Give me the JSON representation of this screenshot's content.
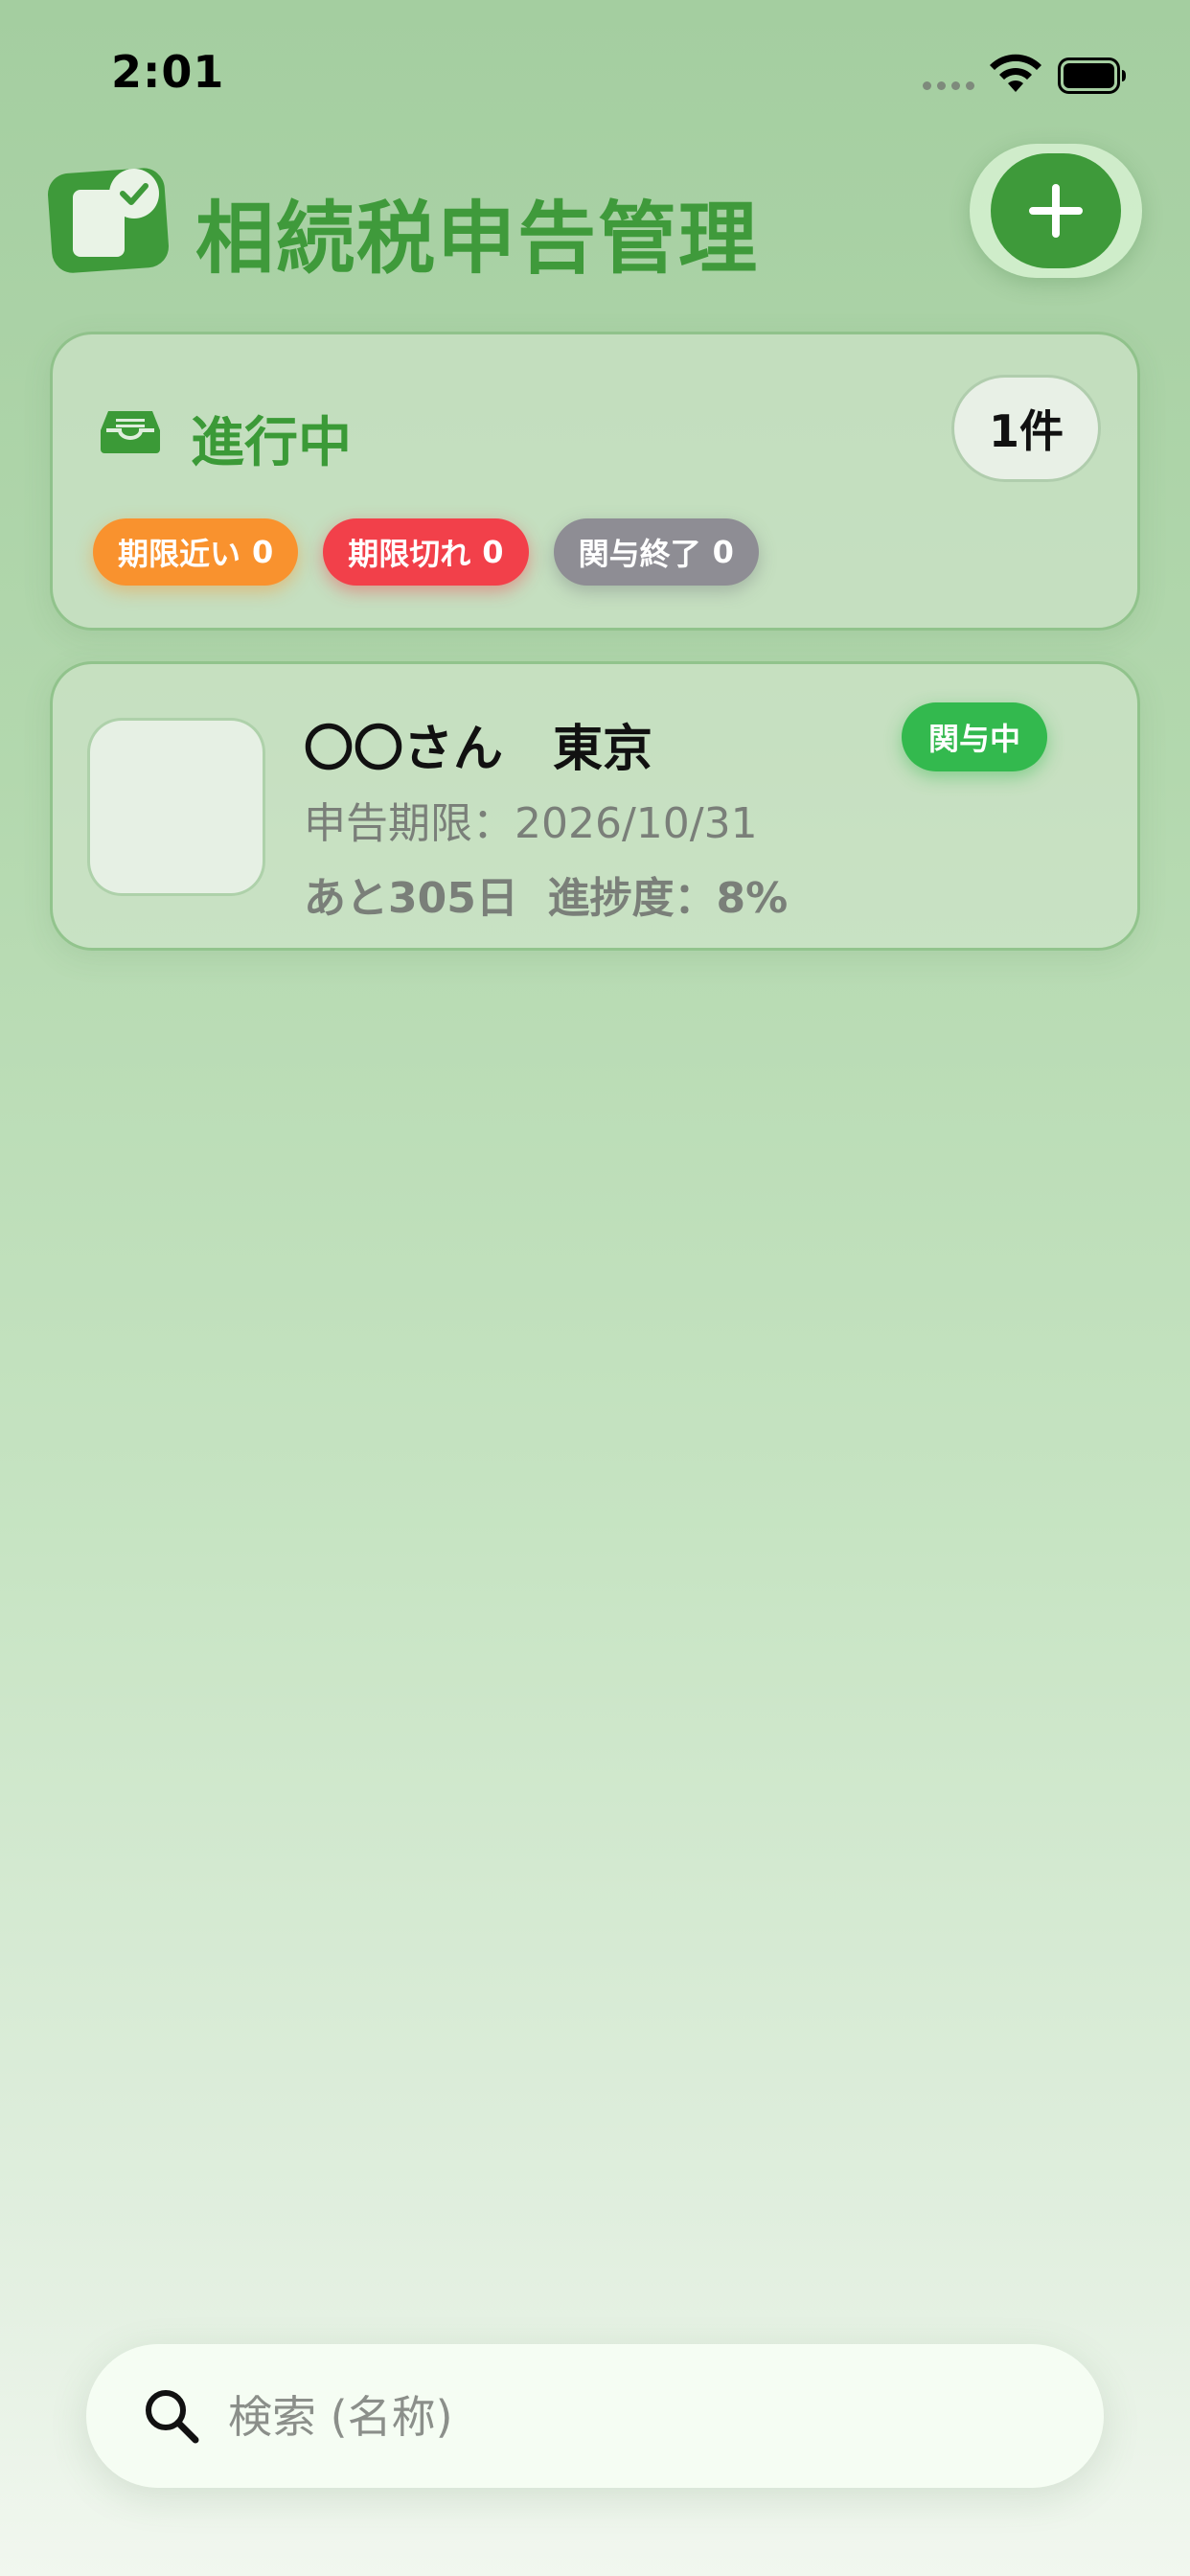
{
  "status_bar": {
    "time": "2:01",
    "icons": [
      "cellular-signal-icon",
      "wifi-icon",
      "battery-icon"
    ]
  },
  "header": {
    "title": "相続税申告管理",
    "app_icon": "document-check-icon",
    "add_button_icon": "plus-icon"
  },
  "progress_card": {
    "icon": "inbox-tray-icon",
    "title": "進行中",
    "count": "1件",
    "badges": [
      {
        "label": "期限近い",
        "count": "0",
        "color": "#f9922e"
      },
      {
        "label": "期限切れ",
        "count": "0",
        "color": "#f2404a"
      },
      {
        "label": "関与終了",
        "count": "0",
        "color": "#8e8d94"
      }
    ]
  },
  "clients": [
    {
      "name": "〇〇さん　東京",
      "status": "関与中",
      "status_color": "#33b94e",
      "deadline": "申告期限：2026/10/31",
      "remaining": "あと305日  進捗度：8%"
    }
  ],
  "search": {
    "icon": "search-icon",
    "placeholder": "検索 (名称)"
  },
  "colors": {
    "accent": "#3e9a3a",
    "title_green": "#3f9a3b"
  }
}
